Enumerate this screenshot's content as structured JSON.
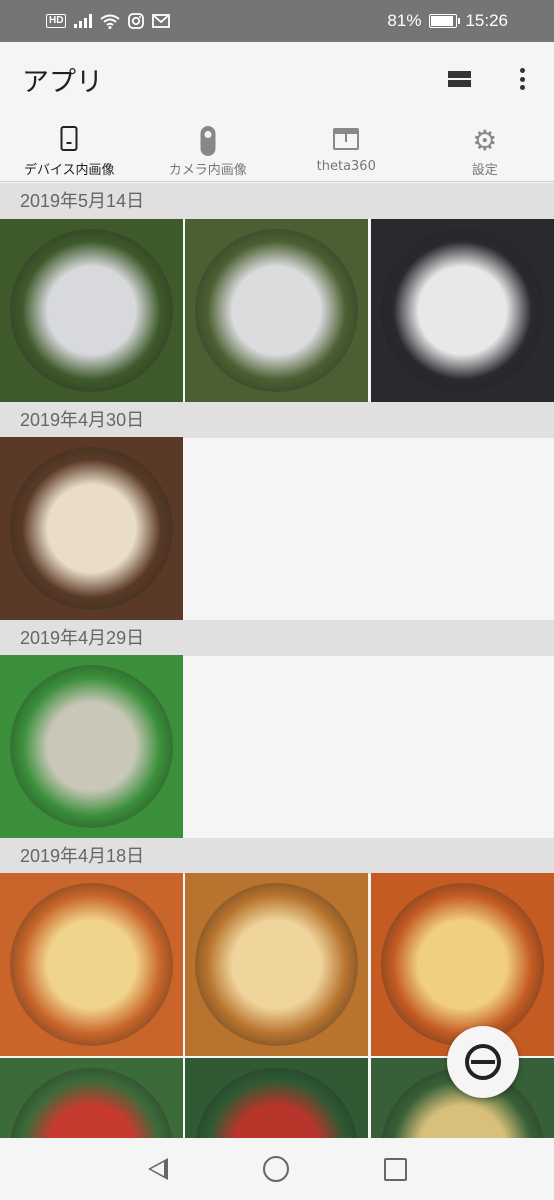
{
  "status_bar": {
    "hd_badge": "HD",
    "battery_text": "81%",
    "battery_level": 0.81,
    "time": "15:26",
    "left_icons": [
      "hd-icon",
      "signal-icon",
      "wifi-icon",
      "instagram-icon",
      "mail-icon"
    ]
  },
  "app_bar": {
    "title": "アプリ",
    "view_toggle_icon": "view-stream-icon",
    "more_icon": "more-vert-icon"
  },
  "tabs": [
    {
      "label": "デバイス内画像",
      "icon": "phone-icon",
      "active": true
    },
    {
      "label": "カメラ内画像",
      "icon": "camera-icon",
      "active": false
    },
    {
      "label": "theta360",
      "icon": "web-window-icon",
      "active": false
    },
    {
      "label": "設定",
      "icon": "gear-icon",
      "active": false
    }
  ],
  "gallery": [
    {
      "date": "2019年5月14日",
      "count": 3,
      "colors": [
        [
          "#3e5a2b",
          "#d8d9dc"
        ],
        [
          "#4b6032",
          "#dcdcdf"
        ],
        [
          "#2a2a2e",
          "#e8e8ea"
        ]
      ]
    },
    {
      "date": "2019年4月30日",
      "count": 1,
      "colors": [
        [
          "#5a3a26",
          "#e9dcc9"
        ]
      ]
    },
    {
      "date": "2019年4月29日",
      "count": 1,
      "colors": [
        [
          "#3b8f3b",
          "#c9c7b8"
        ]
      ]
    },
    {
      "date": "2019年4月18日",
      "count": 6,
      "colors": [
        [
          "#c9652a",
          "#f1d48c"
        ],
        [
          "#b8742e",
          "#efd59c"
        ],
        [
          "#c45b22",
          "#f0cf83"
        ],
        [
          "#3c6b3a",
          "#c73a2f"
        ],
        [
          "#2f5a33",
          "#b8352b"
        ],
        [
          "#386038",
          "#d8c07a"
        ]
      ]
    }
  ],
  "fab": {
    "icon": "theta-capture-icon"
  },
  "nav_bar": {
    "icons": [
      "back-icon",
      "home-icon",
      "recents-icon"
    ]
  }
}
